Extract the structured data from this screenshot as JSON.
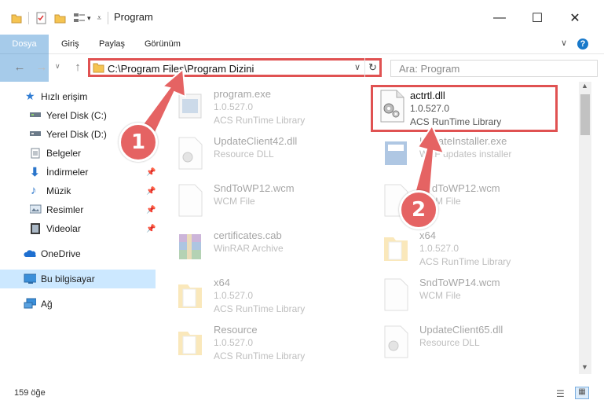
{
  "window": {
    "title": "Program",
    "minimize": "—",
    "maximize": "☐",
    "close": "✕"
  },
  "ribbon": {
    "tabs": [
      "Dosya",
      "Giriş",
      "Paylaş",
      "Görünüm"
    ],
    "help": "?"
  },
  "nav": {
    "back": "←",
    "forward": "→",
    "up": "↑",
    "address": "C:\\Program Files\\Program Dizini",
    "search_placeholder": "Ara: Program"
  },
  "sidebar": {
    "items": [
      {
        "label": "Hızlı erişim",
        "icon": "star-icon",
        "pinned": false
      },
      {
        "label": "Yerel Disk (C:)",
        "icon": "drive-icon",
        "pinned": false
      },
      {
        "label": "Yerel Disk (D:)",
        "icon": "drive-icon",
        "pinned": false
      },
      {
        "label": "Belgeler",
        "icon": "documents-icon",
        "pinned": true
      },
      {
        "label": "İndirmeler",
        "icon": "download-icon",
        "pinned": true
      },
      {
        "label": "Müzik",
        "icon": "music-icon",
        "pinned": true
      },
      {
        "label": "Resimler",
        "icon": "pictures-icon",
        "pinned": true
      },
      {
        "label": "Videolar",
        "icon": "videos-icon",
        "pinned": true
      },
      {
        "label": "OneDrive",
        "icon": "cloud-icon",
        "pinned": false
      },
      {
        "label": "Bu bilgisayar",
        "icon": "computer-icon",
        "pinned": false
      },
      {
        "label": "Ağ",
        "icon": "network-icon",
        "pinned": false
      }
    ]
  },
  "files": [
    {
      "name": "program.exe",
      "line2": "1.0.527.0",
      "line3": "ACS RunTime Library",
      "icon": "exe-icon"
    },
    {
      "name": "actrtl.dll",
      "line2": "1.0.527.0",
      "line3": "ACS RunTime Library",
      "icon": "dll-icon"
    },
    {
      "name": "UpdateClient42.dll",
      "line2": "Resource DLL",
      "line3": "",
      "icon": "dll-icon"
    },
    {
      "name": "UpdateInstaller.exe",
      "line2": "WEF updates installer",
      "line3": "",
      "icon": "installer-icon"
    },
    {
      "name": "SndToWP12.wcm",
      "line2": "WCM File",
      "line3": "",
      "icon": "file-icon"
    },
    {
      "name": "SndToWP12.wcm",
      "line2": "WCM File",
      "line3": "",
      "icon": "file-icon"
    },
    {
      "name": "certificates.cab",
      "line2": "WinRAR Archive",
      "line3": "",
      "icon": "archive-icon"
    },
    {
      "name": "x64",
      "line2": "1.0.527.0",
      "line3": "ACS RunTime Library",
      "icon": "folder-icon"
    },
    {
      "name": "x64",
      "line2": "1.0.527.0",
      "line3": "ACS RunTime Library",
      "icon": "folder-icon"
    },
    {
      "name": "SndToWP14.wcm",
      "line2": "WCM File",
      "line3": "",
      "icon": "file-icon"
    },
    {
      "name": "Resource",
      "line2": "1.0.527.0",
      "line3": "ACS RunTime Library",
      "icon": "folder-icon"
    },
    {
      "name": "UpdateClient65.dll",
      "line2": "Resource DLL",
      "line3": "",
      "icon": "dll-icon"
    }
  ],
  "status": {
    "count": "159 öğe"
  },
  "callouts": [
    "1",
    "2"
  ],
  "colors": {
    "accent": "#1979ca",
    "highlight_border": "#e05252",
    "callout": "#e56363",
    "selection": "#cce8ff"
  }
}
